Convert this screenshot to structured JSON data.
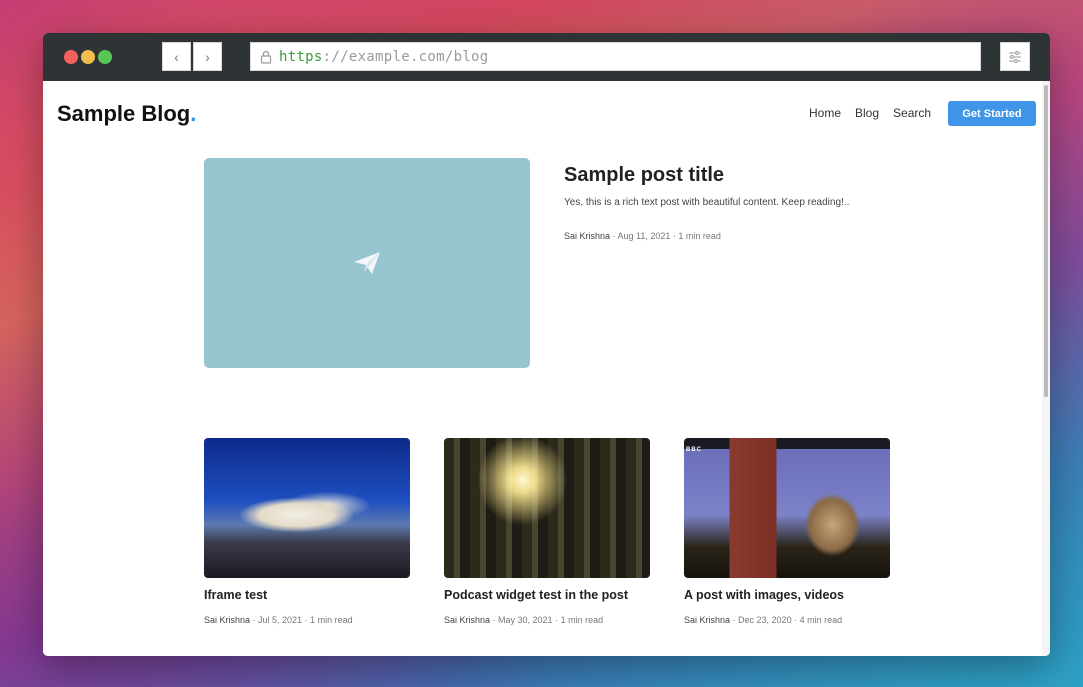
{
  "browser": {
    "url_scheme": "https",
    "url_rest": "://example.com/blog",
    "back_glyph": "‹",
    "forward_glyph": "›",
    "icons": [
      "lock-icon",
      "settings-sliders-icon"
    ]
  },
  "site": {
    "logo_text": "Sample Blog",
    "logo_dot": ".",
    "accent_color": "#3f95e8"
  },
  "nav": {
    "items": [
      "Home",
      "Blog",
      "Search"
    ],
    "cta_label": "Get Started"
  },
  "featured": {
    "title": "Sample post title",
    "excerpt": "Yes, this is a rich text post with beautiful content. Keep reading!..",
    "author": "Sai Krishna",
    "meta": " · Aug 11, 2021 · 1 min read",
    "image_icon": "paper-plane-icon",
    "image_color": "#96c5d0"
  },
  "posts": [
    {
      "title": "Iframe test",
      "author": "Sai Krishna",
      "meta": " · Jul 5, 2021 · 1 min read"
    },
    {
      "title": "Podcast widget test in the post",
      "author": "Sai Krishna",
      "meta": " · May 30, 2021 · 1 min read"
    },
    {
      "title": "A post with images, videos",
      "author": "Sai Krishna",
      "meta": " · Dec 23, 2020 · 4 min read",
      "watermark": "BBC"
    }
  ]
}
